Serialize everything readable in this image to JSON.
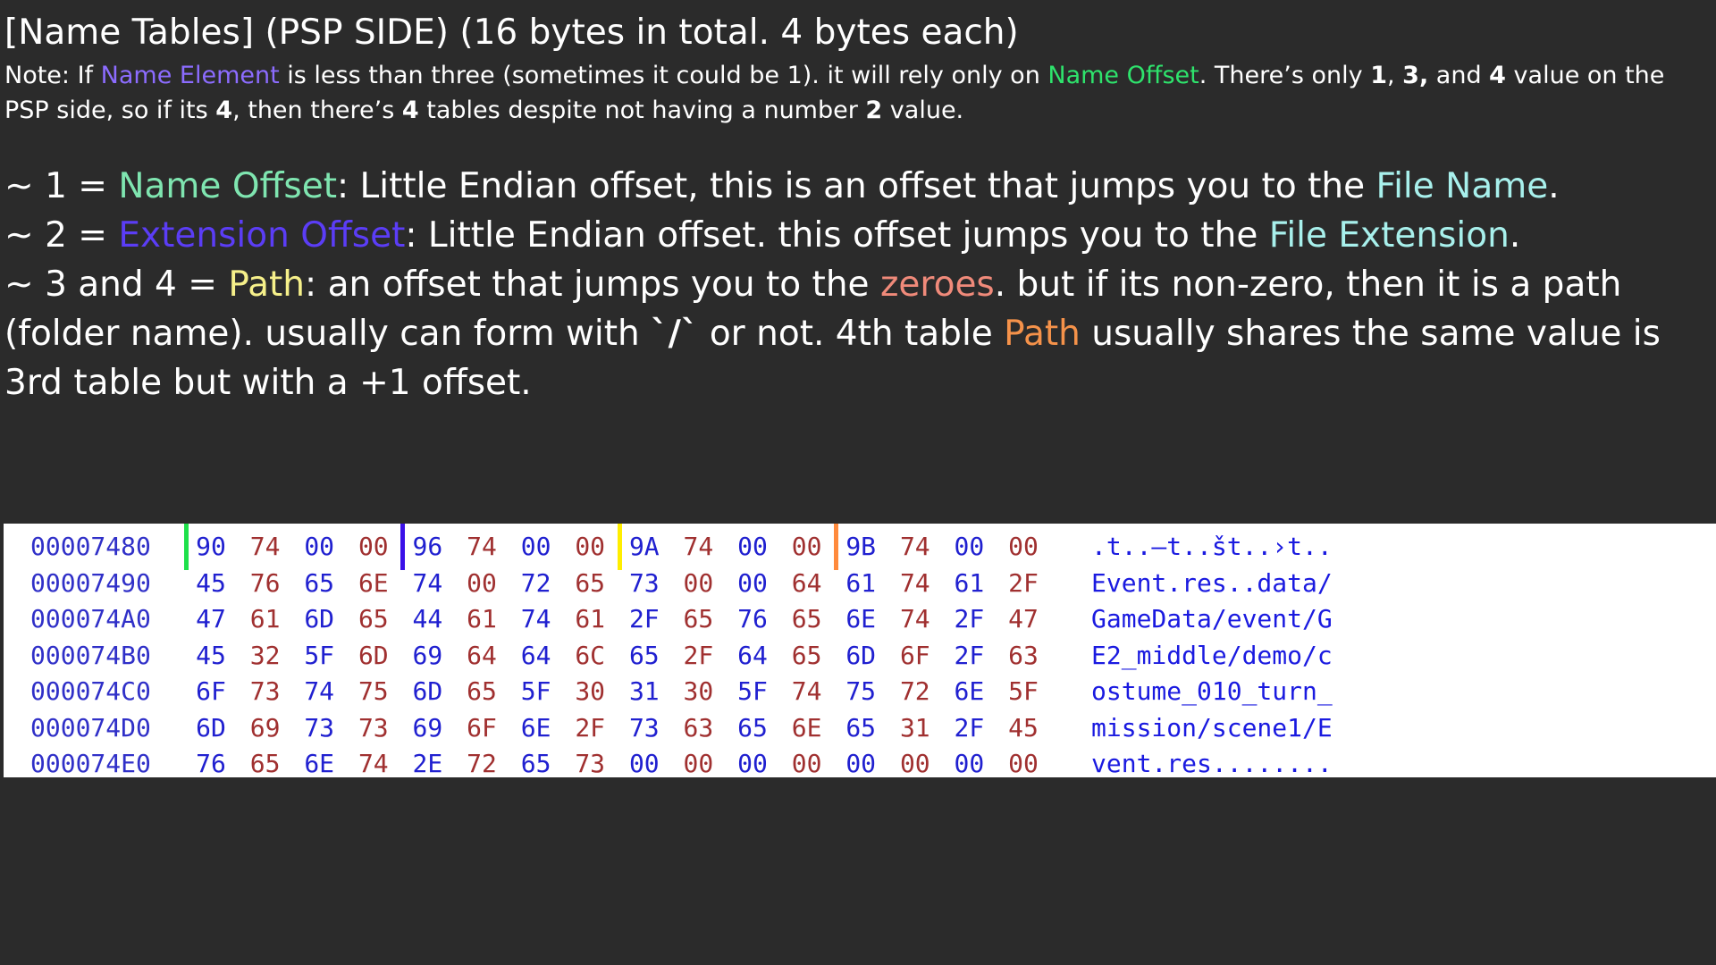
{
  "title": "[Name Tables] (PSP SIDE) (16 bytes in total. 4 bytes each)",
  "note": {
    "p1": "Note: If ",
    "name_element": "Name Element",
    "p2": " is less than three (sometimes it could be 1). it will rely only on ",
    "name_offset": "Name Offset",
    "p3": ".  There’s only ",
    "v1": "1",
    "sep1": ", ",
    "v3": "3,",
    "sep2": " and ",
    "v4": "4",
    "p4": " value on the PSP side, so if its ",
    "v4b": "4",
    "p5": ", then there’s ",
    "v4c": "4",
    "p6": " tables despite not having a number ",
    "v2": "2",
    "p7": " value."
  },
  "definitions": {
    "d1": {
      "prefix": "~ 1 = ",
      "term": "Name Offset",
      "text": ": Little Endian offset, this is an offset that jumps you to the ",
      "target": "File Name",
      "end": "."
    },
    "d2": {
      "prefix": "~  2 = ",
      "term": "Extension Offset",
      "text": ": Little Endian offset. this offset jumps you to the ",
      "target": "File Extension",
      "end": "."
    },
    "d3": {
      "prefix": "~  3 and 4 = ",
      "term": "Path",
      "text": ": an offset that jumps you to the ",
      "zeroes": "zeroes",
      "text2": ". but if its non-zero, then it is a path (folder name). usually can form with ",
      "slash": "`/`",
      "text3": " or not. 4th table ",
      "path2": "Path",
      "text4": " usually shares the same value is 3rd table but with a +1 offset."
    }
  },
  "colors": {
    "name_element": "#8c6cff",
    "name_offset_note": "#2ee36c",
    "name_offset": "#7fe5b0",
    "extension_offset": "#5b3df6",
    "file_targets": "#a8f0ec",
    "path": "#f6f08a",
    "zeroes": "#f08a7a",
    "path_orange": "#f5924a",
    "marker_green": "#1ee04a",
    "marker_blue": "#3a10e8",
    "marker_yellow": "#ffee00",
    "marker_orange": "#ff8a3c"
  },
  "hex_dump": {
    "rows": [
      {
        "addr": "00007480",
        "bytes": [
          "90",
          "74",
          "00",
          "00",
          "96",
          "74",
          "00",
          "00",
          "9A",
          "74",
          "00",
          "00",
          "9B",
          "74",
          "00",
          "00"
        ],
        "ascii": ".t..–t..št..›t.."
      },
      {
        "addr": "00007490",
        "bytes": [
          "45",
          "76",
          "65",
          "6E",
          "74",
          "00",
          "72",
          "65",
          "73",
          "00",
          "00",
          "64",
          "61",
          "74",
          "61",
          "2F"
        ],
        "ascii": "Event.res..data/"
      },
      {
        "addr": "000074A0",
        "bytes": [
          "47",
          "61",
          "6D",
          "65",
          "44",
          "61",
          "74",
          "61",
          "2F",
          "65",
          "76",
          "65",
          "6E",
          "74",
          "2F",
          "47"
        ],
        "ascii": "GameData/event/G"
      },
      {
        "addr": "000074B0",
        "bytes": [
          "45",
          "32",
          "5F",
          "6D",
          "69",
          "64",
          "64",
          "6C",
          "65",
          "2F",
          "64",
          "65",
          "6D",
          "6F",
          "2F",
          "63"
        ],
        "ascii": "E2_middle/demo/c"
      },
      {
        "addr": "000074C0",
        "bytes": [
          "6F",
          "73",
          "74",
          "75",
          "6D",
          "65",
          "5F",
          "30",
          "31",
          "30",
          "5F",
          "74",
          "75",
          "72",
          "6E",
          "5F"
        ],
        "ascii": "ostume_010_turn_"
      },
      {
        "addr": "000074D0",
        "bytes": [
          "6D",
          "69",
          "73",
          "73",
          "69",
          "6F",
          "6E",
          "2F",
          "73",
          "63",
          "65",
          "6E",
          "65",
          "31",
          "2F",
          "45"
        ],
        "ascii": "mission/scene1/E"
      },
      {
        "addr": "000074E0",
        "bytes": [
          "76",
          "65",
          "6E",
          "74",
          "2E",
          "72",
          "65",
          "73",
          "00",
          "00",
          "00",
          "00",
          "00",
          "00",
          "00",
          "00"
        ],
        "ascii": "vent.res........"
      }
    ],
    "markers": [
      {
        "before_byte": 0,
        "color_key": "marker_green"
      },
      {
        "before_byte": 4,
        "color_key": "marker_blue"
      },
      {
        "before_byte": 8,
        "color_key": "marker_yellow"
      },
      {
        "before_byte": 12,
        "color_key": "marker_orange"
      }
    ]
  }
}
